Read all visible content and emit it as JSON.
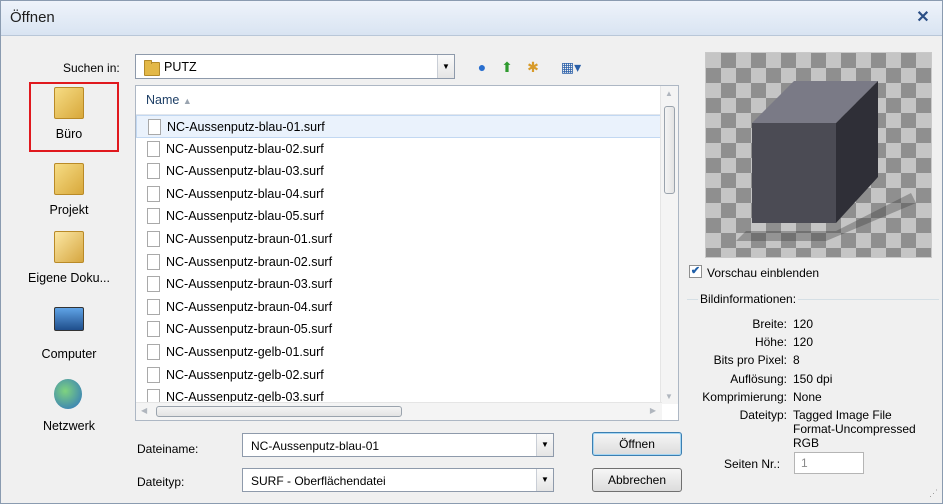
{
  "window": {
    "title": "Öffnen"
  },
  "lookin": {
    "label": "Suchen in:",
    "value": "PUTZ"
  },
  "toolbar_icons": [
    "back-icon",
    "up-folder-icon",
    "new-folder-icon",
    "view-menu-icon"
  ],
  "places": [
    {
      "label": "Büro",
      "icon": "folder-icon"
    },
    {
      "label": "Projekt",
      "icon": "folder-icon"
    },
    {
      "label": "Eigene Doku...",
      "icon": "documents-icon"
    },
    {
      "label": "Computer",
      "icon": "computer-icon"
    },
    {
      "label": "Netzwerk",
      "icon": "network-icon"
    }
  ],
  "list": {
    "column_header": "Name",
    "files": [
      "NC-Aussenputz-blau-01.surf",
      "NC-Aussenputz-blau-02.surf",
      "NC-Aussenputz-blau-03.surf",
      "NC-Aussenputz-blau-04.surf",
      "NC-Aussenputz-blau-05.surf",
      "NC-Aussenputz-braun-01.surf",
      "NC-Aussenputz-braun-02.surf",
      "NC-Aussenputz-braun-03.surf",
      "NC-Aussenputz-braun-04.surf",
      "NC-Aussenputz-braun-05.surf",
      "NC-Aussenputz-gelb-01.surf",
      "NC-Aussenputz-gelb-02.surf",
      "NC-Aussenputz-gelb-03.surf"
    ]
  },
  "filename": {
    "label": "Dateiname:",
    "value": "NC-Aussenputz-blau-01"
  },
  "filetype": {
    "label": "Dateityp:",
    "value": "SURF - Oberflächendatei"
  },
  "buttons": {
    "open": "Öffnen",
    "cancel": "Abbrechen"
  },
  "preview": {
    "checkbox_label": "Vorschau einblenden",
    "checked": true,
    "info_title": "Bildinformationen:",
    "fields": [
      {
        "key": "Breite:",
        "value": "120"
      },
      {
        "key": "Höhe:",
        "value": "120"
      },
      {
        "key": "Bits pro Pixel:",
        "value": "8"
      },
      {
        "key": "Auflösung:",
        "value": "150 dpi"
      },
      {
        "key": "Komprimierung:",
        "value": "None"
      },
      {
        "key": "Dateityp:",
        "value": "Tagged Image File Format-Uncompressed RGB"
      }
    ],
    "page_label": "Seiten Nr.:",
    "page_value": "1"
  },
  "colors": {
    "highlight": "#e0191e",
    "selection": "#eaf2fc",
    "title_text": "#1e1e1e"
  }
}
